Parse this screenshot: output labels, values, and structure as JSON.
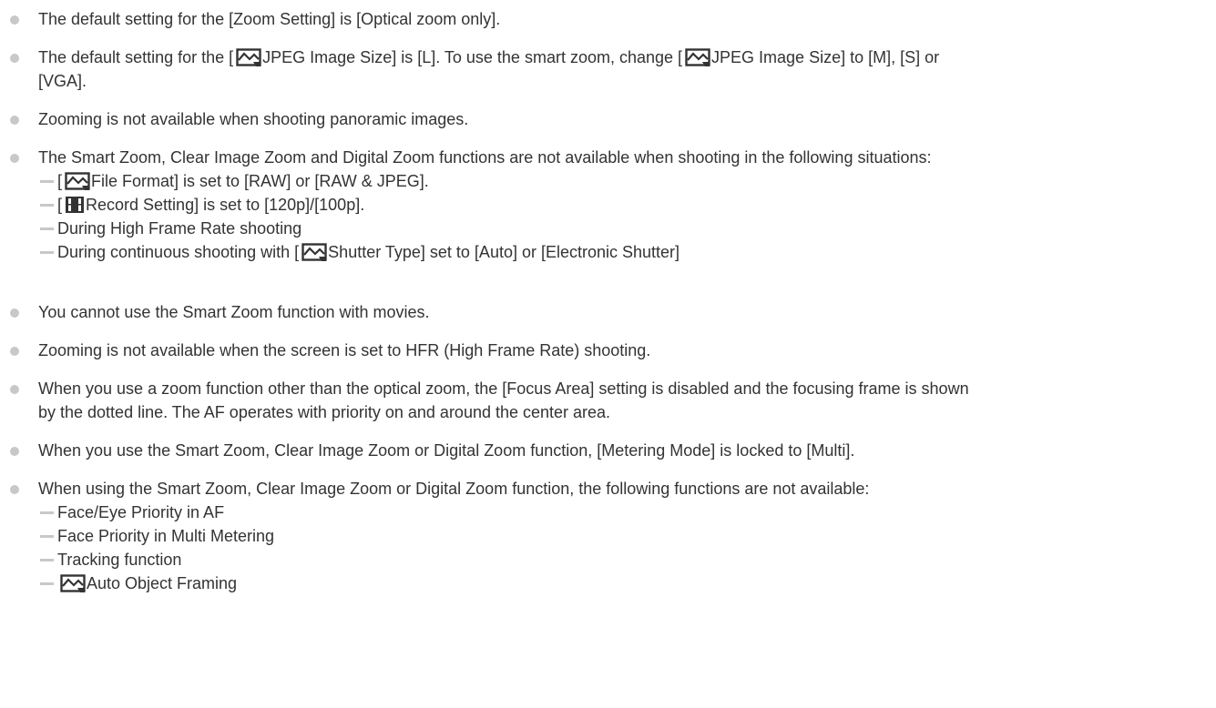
{
  "notes": {
    "zoom_default": {
      "text": "The default setting for the [Zoom Setting] is [Optical zoom only]."
    },
    "jpeg_size": {
      "p1": "The default setting for the [",
      "p2": "JPEG Image Size] is [L]. To use the smart zoom, change [",
      "p3": "JPEG Image Size] to [M], [S] or",
      "line2": "[VGA]."
    },
    "panoramic": {
      "text": "Zooming is not available when shooting panoramic images."
    },
    "unavailable_situations": {
      "text": "The Smart Zoom, Clear Image Zoom and Digital Zoom functions are not available when shooting in the following situations:",
      "items": {
        "file_format": {
          "pre": "[",
          "post": "File Format] is set to [RAW] or [RAW & JPEG]."
        },
        "record_setting": {
          "pre": "[",
          "post": "Record Setting] is set to [120p]/[100p]."
        },
        "hfr": {
          "text": "During High Frame Rate shooting"
        },
        "shutter": {
          "pre": "During continuous shooting with [",
          "post": "Shutter Type] set to [Auto] or [Electronic Shutter]"
        }
      }
    },
    "movies": {
      "text": "You cannot use the Smart Zoom function with movies."
    },
    "hfr_screen": {
      "text": "Zooming is not available when the screen is set to HFR (High Frame Rate) shooting."
    },
    "focus_area": {
      "line1": "When you use a zoom function other than the optical zoom, the [Focus Area] setting is disabled and the focusing frame is shown",
      "line2": "by the dotted line. The AF operates with priority on and around the center area."
    },
    "metering": {
      "text": "When you use the Smart Zoom, Clear Image Zoom or Digital Zoom function, [Metering Mode] is locked to [Multi]."
    },
    "functions_unavailable": {
      "text": "When using the Smart Zoom, Clear Image Zoom or Digital Zoom function, the following functions are not available:",
      "items": {
        "face_eye": {
          "text": "Face/Eye Priority in AF"
        },
        "face_metering": {
          "text": "Face Priority in Multi Metering"
        },
        "tracking": {
          "text": "Tracking function"
        },
        "auto_framing": {
          "text": "Auto Object Framing"
        }
      }
    }
  },
  "icons": {
    "still_image": "still-image-icon",
    "movie": "movie-icon"
  },
  "colors": {
    "text": "#333333",
    "bullet": "#c8c8c8"
  }
}
